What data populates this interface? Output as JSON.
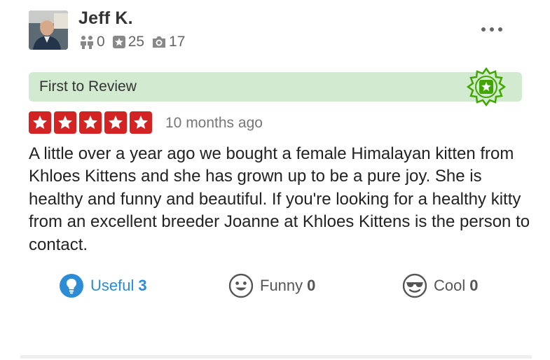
{
  "user": {
    "name": "Jeff K.",
    "friends_count": "0",
    "reviews_count": "25",
    "photos_count": "17"
  },
  "banner": {
    "label": "First to Review"
  },
  "review": {
    "rating": 5,
    "max_rating": 5,
    "date": "10 months ago",
    "text": "A little over a year ago we bought a female Himalayan kitten from Khloes Kittens and she has grown up to be a pure joy.  She is healthy and funny and beautiful.  If you're looking for a healthy kitty from an excellent breeder Joanne at Khloes Kittens is the person to contact."
  },
  "actions": {
    "useful_label": "Useful",
    "useful_count": "3",
    "funny_label": "Funny",
    "funny_count": "0",
    "cool_label": "Cool",
    "cool_count": "0"
  },
  "colors": {
    "star_red": "#d32323",
    "banner_green": "#d2ebd0",
    "badge_green": "#41a700",
    "useful_blue": "#2d8cd6"
  },
  "icons": [
    "avatar-photo",
    "friends-icon",
    "star-icon",
    "camera-icon",
    "more-icon",
    "first-to-review-badge-icon",
    "lightbulb-icon",
    "smiley-icon",
    "sunglasses-smiley-icon"
  ]
}
